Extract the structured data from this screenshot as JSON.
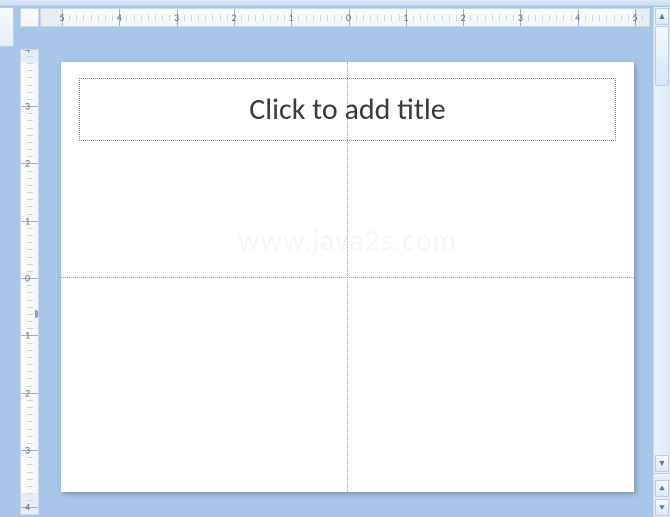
{
  "ruler": {
    "horizontal_labels": [
      5,
      4,
      3,
      2,
      1,
      0,
      1,
      2,
      3,
      4,
      5
    ],
    "vertical_labels": [
      3,
      2,
      1,
      0,
      1,
      2,
      3
    ]
  },
  "slide": {
    "title_placeholder": "Click to add title",
    "watermark": "www.java2s.com",
    "guide_vertical_inch": 0.0,
    "guide_horizontal_inch": 0.0
  },
  "colors": {
    "workspace_bg": "#a9c5e7",
    "slide_bg": "#ffffff"
  },
  "scrollbar": {
    "up": "▲",
    "down": "▼",
    "prev": "⯅",
    "next": "⯆"
  }
}
